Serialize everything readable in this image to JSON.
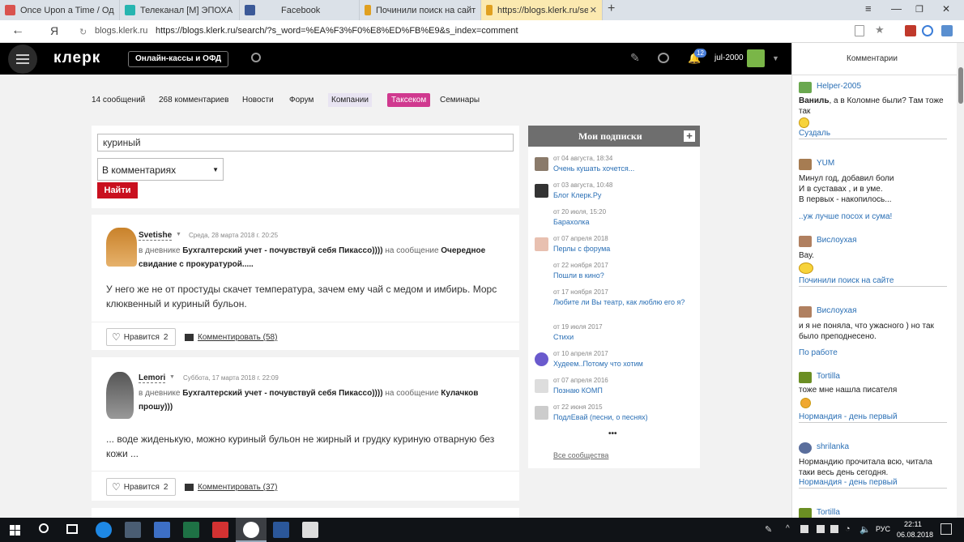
{
  "browser": {
    "tabs": [
      {
        "title": "Once Upon a Time / Однаж",
        "color": "#d9534f"
      },
      {
        "title": "Телеканал [M] ЭПОХА HD -",
        "color": "#27b5b0"
      },
      {
        "title": "Facebook",
        "color": "#3b5998"
      },
      {
        "title": "Починили поиск на сайте",
        "color": "#e0a020"
      },
      {
        "title": "https://blogs.klerk.ru/sea",
        "color": "#e0a020"
      }
    ],
    "new_tab": "+",
    "window_controls": [
      "≡",
      "—",
      "❐",
      "✕"
    ],
    "yandex_logo": "Я",
    "site_short": "blogs.klerk.ru",
    "url": "https://blogs.klerk.ru/search/?s_word=%EA%F3%F0%E8%ED%FB%E9&s_index=comment"
  },
  "header": {
    "logo": "клерк",
    "online_kassy": "Онлайн-кассы и ОФД",
    "notif_count": "12",
    "username": "jul-2000"
  },
  "nav": [
    "14 сообщений",
    "268 комментариев",
    "Новости",
    "Форум",
    "Компании",
    "Таксеком",
    "Семинары"
  ],
  "search": {
    "query": "куриный",
    "scope": "В комментариях",
    "submit": "Найти"
  },
  "results": [
    {
      "author": "Svetishe",
      "date": "Среда, 28 марта 2018 г. 20:25",
      "in_diary": "в дневнике",
      "diary": "Бухгалтерский учет - почувствуй себя Пикассо))))",
      "on_post": "на сообщение",
      "post": "Очередное свидание с прокуратурой.....",
      "text": "У него же не от простуды скачет температура, зачем ему чай с медом и имбирь. Морс клюквенный и куриный бульон.",
      "like_label": "Нравится",
      "likes": "2",
      "comment_label": "Комментировать (58)"
    },
    {
      "author": "Lemori",
      "date": "Суббота, 17 марта 2018 г. 22:09",
      "in_diary": "в дневнике",
      "diary": "Бухгалтерский учет - почувствуй себя Пикассо))))",
      "on_post": "на сообщение",
      "post": "Кулачков прошу)))",
      "text": "... воде жиденькую, можно куриный бульон не жирный и грудку куриную отварную без кожи ...",
      "like_label": "Нравится",
      "likes": "2",
      "comment_label": "Комментировать (37)"
    }
  ],
  "subscriptions": {
    "title": "Мои подписки",
    "add": "+",
    "items": [
      {
        "date": "от 04 августа, 18:34",
        "title": "Очень кушать хочется..."
      },
      {
        "date": "от 03 августа, 10:48",
        "title": "Блог Клерк.Ру"
      },
      {
        "date": "от 20 июля, 15:20",
        "title": "Барахолка"
      },
      {
        "date": "от 07 апреля 2018",
        "title": "Перлы с форума"
      },
      {
        "date": "от 22 ноября 2017",
        "title": "Пошли в кино?"
      },
      {
        "date": "от 17 ноября 2017",
        "title": "Любите ли Вы театр, как люблю его я?"
      },
      {
        "date": "от 19 июля 2017",
        "title": "Стихи"
      },
      {
        "date": "от 10 апреля 2017",
        "title": "Худеем..Потому что хотим"
      },
      {
        "date": "от 07 апреля 2016",
        "title": "Познаю КОМП"
      },
      {
        "date": "от 22 июня 2015",
        "title": "ПодлЕвай (песни, о песнях)"
      }
    ],
    "more": "•••",
    "all": "Все сообщества"
  },
  "comments_panel": {
    "title": "Комментарии",
    "items": [
      {
        "user": "Helper-2005",
        "text_bold": "Ваниль",
        "text": ", а в Коломне были? Там тоже так",
        "link": "Суздаль"
      },
      {
        "user": "YUM",
        "text": "Минул год, добавил боли\nИ в суставах , и в уме.\nВ первых - накопилось...",
        "link": "..уж лучше посох и сума!"
      },
      {
        "user": "Вислоухая",
        "text": "Вау.",
        "link": "Починили поиск на сайте"
      },
      {
        "user": "Вислоухая",
        "text": "и я не поняла, что ужасного ) но так было преподнесено.",
        "link": "По работе"
      },
      {
        "user": "Tortilla",
        "text": "тоже мне нашла писателя",
        "link": "Нормандия - день первый"
      },
      {
        "user": "shrilanka",
        "text": "Нормандию прочитала всю, читала таки весь день сегодня.",
        "link": "Нормандия - день первый"
      },
      {
        "user": "Tortilla"
      }
    ]
  },
  "taskbar": {
    "lang": "РУС",
    "time": "22:11",
    "date": "06.08.2018"
  }
}
